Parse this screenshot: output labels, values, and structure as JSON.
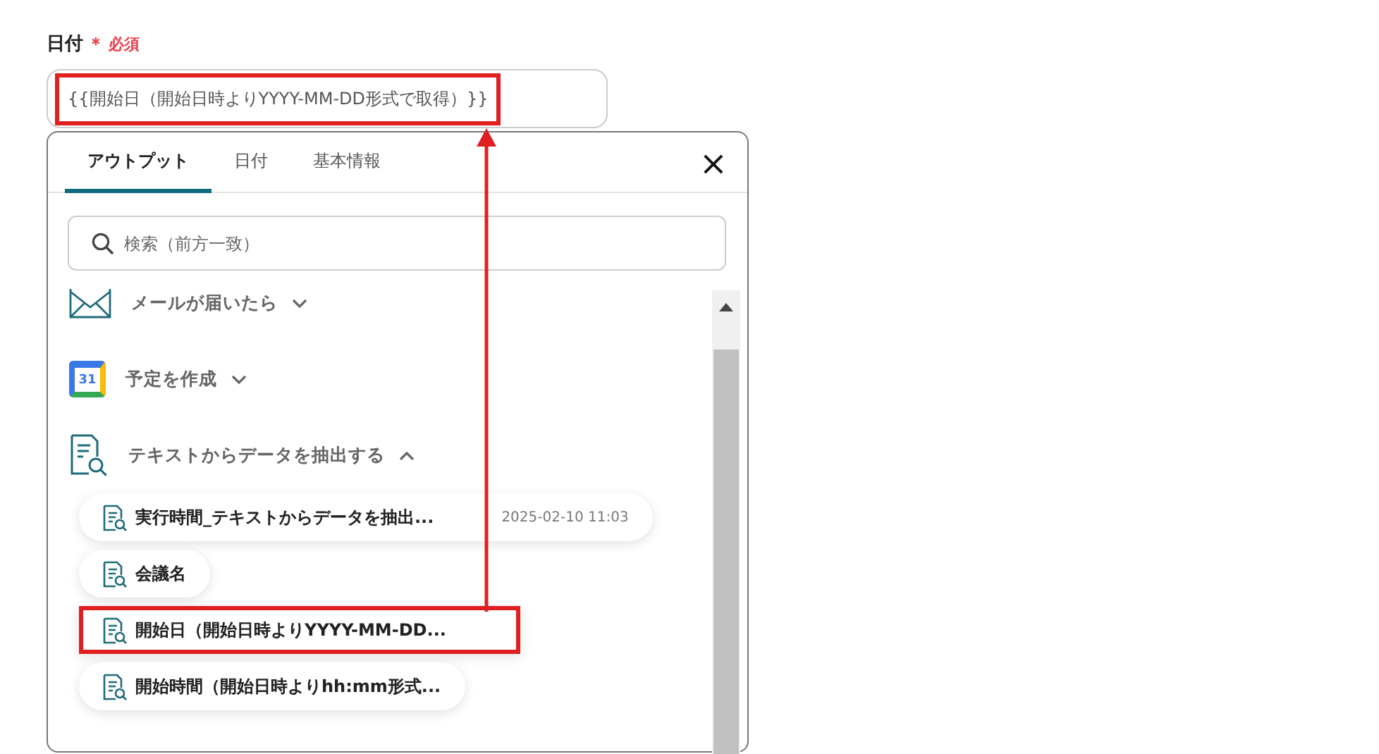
{
  "field": {
    "label": "日付",
    "required_mark": "＊",
    "required_text": "必須",
    "value": "{{開始日（開始日時よりYYYY-MM-DD形式で取得）}}",
    "highlighted": true
  },
  "popup": {
    "tabs": [
      {
        "label": "アウトプット",
        "selected": true
      },
      {
        "label": "日付",
        "selected": false
      },
      {
        "label": "基本情報",
        "selected": false
      }
    ],
    "close": "×",
    "search": {
      "placeholder": "検索（前方一致）"
    },
    "groups": [
      {
        "kind": "mail",
        "title": "メールが届いたら",
        "expanded": false
      },
      {
        "kind": "calendar",
        "title": "予定を作成",
        "icon_label": "31",
        "expanded": false
      },
      {
        "kind": "extract",
        "title": "テキストからデータを抽出する",
        "expanded": true,
        "items": [
          {
            "label": "実行時間_テキストからデータを抽出...",
            "value": "2025-02-10 11:03",
            "highlighted": false
          },
          {
            "label": "会議名",
            "highlighted": false
          },
          {
            "label": "開始日（開始日時よりYYYY-MM-DD...",
            "highlighted": true
          },
          {
            "label": "開始時間（開始日時よりhh:mm形式...",
            "highlighted": false
          }
        ]
      }
    ]
  },
  "annotation": {
    "arrow": true
  }
}
